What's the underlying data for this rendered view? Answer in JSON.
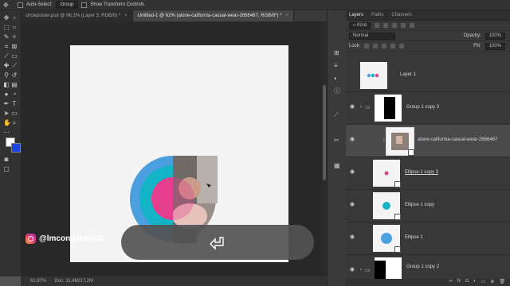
{
  "options": {
    "auto_select_label": "Auto-Select:",
    "auto_select_value": "Group",
    "transform_controls_label": "Show Transform Controls"
  },
  "tabs": [
    {
      "label": "circleposter.psd @ 96,1% (Layer 3, RGB/8) *",
      "active": false
    },
    {
      "label": "Untitled-1 @ 62% (alone-california-casual-wear-2666467, RGB/8*) *",
      "active": true
    }
  ],
  "status": {
    "zoom": "61,87%",
    "doc": "Doc: 11,4M/27,2M"
  },
  "watermark": "@lmcongstudio2",
  "panel": {
    "tabs": [
      "Layers",
      "Paths",
      "Channels"
    ],
    "kind": "Kind",
    "blend_mode": "Normal",
    "opacity_label": "Opacity:",
    "opacity_value": "100%",
    "lock_label": "Lock:",
    "fill_label": "Fill:",
    "fill_value": "100%"
  },
  "layers": [
    {
      "name": "Layer 1",
      "kind": "layer1"
    },
    {
      "name": "Group 1 copy 3",
      "kind": "group"
    },
    {
      "name": "alone-california-casual-wear-2666467",
      "kind": "photo",
      "selected": true
    },
    {
      "name": "Ellipse 1 copy 3",
      "kind": "ellipse",
      "color": "#e0408a",
      "underline": true
    },
    {
      "name": "Ellipse 1 copy",
      "kind": "ellipse",
      "color": "#1bb3c4"
    },
    {
      "name": "Ellipse 1",
      "kind": "ellipse",
      "color": "#4aa3e0"
    },
    {
      "name": "Group 1 copy 2",
      "kind": "group2"
    }
  ],
  "colors": {
    "pink": "#e63e8f",
    "teal": "#13b4c6",
    "blue": "#4b9fde",
    "fg": "#ffffff",
    "bg": "#1a44e0"
  }
}
